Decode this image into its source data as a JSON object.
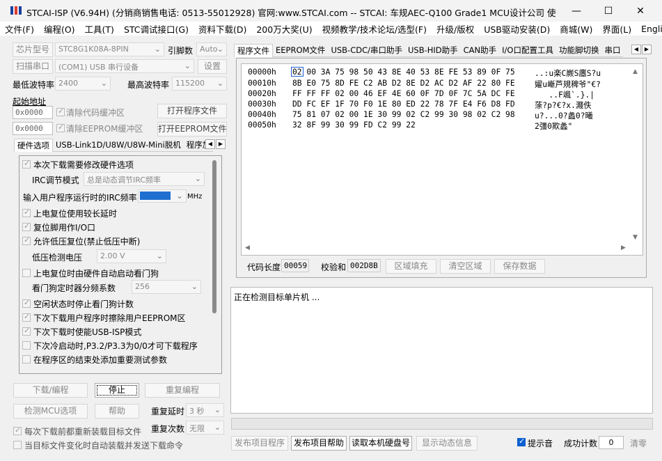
{
  "window": {
    "title": "STCAI-ISP (V6.94H) (分销商销售电话: 0513-55012928) 官网:www.STCAI.com  -- STCAI: 车规AEC-Q100 Grade1 MCU设计公司 使用本司芯片或采..."
  },
  "menu": [
    "文件(F)",
    "编程(O)",
    "工具(T)",
    "STC调试接口(G)",
    "资料下载(D)",
    "200万大奖(U)",
    "视频教学/技术论坛/选型(F)",
    "升级/版权",
    "USB驱动安装(D)",
    "商城(W)",
    "界面(L)",
    "English"
  ],
  "left": {
    "chip_label": "芯片型号",
    "chip_value": "STC8G1K08A-8PIN",
    "pin_label": "引脚数",
    "pin_value": "Auto",
    "scan_btn": "扫描串口",
    "port_value": "(COM1) USB 串行设备",
    "settings_btn": "设置",
    "min_baud_label": "最低波特率",
    "min_baud_value": "2400",
    "max_baud_label": "最高波特率",
    "max_baud_value": "115200",
    "start_addr_label": "起始地址",
    "addr1_value": "0x0000",
    "clear_code_label": "清除代码缓冲区",
    "open_prog_btn": "打开程序文件",
    "addr2_value": "0x0000",
    "clear_eeprom_label": "清除EEPROM缓冲区",
    "open_eeprom_btn": "打开EEPROM文件"
  },
  "hw_tabs": [
    "硬件选项",
    "USB-Link1D/U8W/U8W-Mini脱机",
    "程序加"
  ],
  "hw": {
    "opt1": "本次下载需要修改硬件选项",
    "irc_mode_label": "IRC调节模式",
    "irc_mode_value": "总是动态调节IRC频率",
    "irc_freq_label": "输入用户程序运行时的IRC频率",
    "irc_freq_unit": "MHz",
    "opt2": "上电复位使用较长延时",
    "opt3": "复位脚用作I/O口",
    "opt4": "允许低压复位(禁止低压中断)",
    "lv_label": "低压检测电压",
    "lv_value": "2.00 V",
    "opt5": "上电复位时由硬件自动启动看门狗",
    "wdt_label": "看门狗定时器分频系数",
    "wdt_value": "256",
    "opt6": "空闲状态时停止看门狗计数",
    "opt7": "下次下载用户程序时擦除用户EEPROM区",
    "opt8": "下次下载时使能USB-ISP模式",
    "opt9": "下次冷启动时,P3.2/P3.3为0/0才可下载程序",
    "opt10": "在程序区的结束处添加重要测试参数"
  },
  "bottom_left": {
    "download_btn": "下载/编程",
    "stop_btn": "停止",
    "reprog_btn": "重复编程",
    "detect_btn": "检测MCU选项",
    "help_btn": "帮助",
    "repeat_delay_label": "重复延时",
    "repeat_delay_value": "3 秒",
    "reload_label": "每次下载前都重新装载目标文件",
    "repeat_count_label": "重复次数",
    "repeat_count_value": "无限",
    "auto_send_label": "当目标文件变化时自动装载并发送下载命令"
  },
  "right_tabs": [
    "程序文件",
    "EEPROM文件",
    "USB-CDC/串口助手",
    "USB-HID助手",
    "CAN助手",
    "I/O口配置工具",
    "功能脚切换",
    "串口"
  ],
  "hex": {
    "rows": [
      {
        "addr": "00000h",
        "bytes": "02 00 3A 75 98 50 43 8E 40 53 8E FE 53 89 0F 75",
        "ascii": "..:u楽C嶡S廛S?u"
      },
      {
        "addr": "00010h",
        "bytes": "8B E0 75 8D FE C2 AB D2 8E D2 AC D2 AF 22 80 FE",
        "ascii": "嬥u嶃芦規稗爷\"€?"
      },
      {
        "addr": "00020h",
        "bytes": "FF FF FF 02 00 46 EF 4E 60 0F 7D 0F 7C 5A DC FE",
        "ascii": "   ..F颯`.}.|"
      },
      {
        "addr": "00030h",
        "bytes": "DD FC EF 1F 70 F0 1E 80 ED 22 78 7F E4 F6 D8 FD",
        "ascii": "蒤?p?€?x.濺佚"
      },
      {
        "addr": "00040h",
        "bytes": "75 81 07 02 00 1E 30 99 02 C2 99 30 98 02 C2 98",
        "ascii": "u?...0?蠡0?曦"
      },
      {
        "addr": "00050h",
        "bytes": "32 8F 99 30 99 FD C2 99 22",
        "ascii": "2彊0欺蠡\""
      }
    ]
  },
  "codebar": {
    "len_label": "代码长度",
    "len_value": "00059",
    "checksum_label": "校验和",
    "checksum_value": "002D8B",
    "fill_btn": "区域填充",
    "clear_btn": "清空区域",
    "save_btn": "保存数据"
  },
  "log": {
    "text": "正在检测目标单片机 ..."
  },
  "bottom_right": {
    "publish_prog_btn": "发布项目程序",
    "publish_help_btn": "发布项目帮助",
    "read_disk_btn": "读取本机硬盘号",
    "show_info_btn": "显示动态信息",
    "beep_label": "提示音",
    "success_label": "成功计数",
    "success_value": "0",
    "clear_btn": "清零"
  }
}
